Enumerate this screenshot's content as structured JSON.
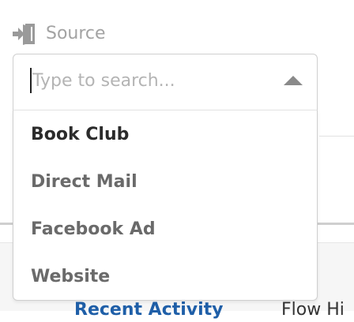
{
  "field": {
    "label": "Source",
    "icon": "sign-in-icon"
  },
  "search": {
    "placeholder": "Type to search...",
    "value": ""
  },
  "dropdown": {
    "options": [
      {
        "label": "Book Club",
        "highlighted": true
      },
      {
        "label": "Direct Mail",
        "highlighted": false
      },
      {
        "label": "Facebook Ad",
        "highlighted": false
      },
      {
        "label": "Website",
        "highlighted": false
      }
    ]
  },
  "background": {
    "tabs": [
      {
        "label": "Recent Activity",
        "active": true
      },
      {
        "label": "Flow Hi",
        "active": false
      }
    ]
  },
  "colors": {
    "label_gray": "#a3a3a3",
    "placeholder_gray": "#b4b4b4",
    "option_highlight": "#2b2b2b",
    "option_text": "#6a6a6a",
    "border": "#cfcfcf",
    "tab_active_blue": "#1f5fa8"
  }
}
